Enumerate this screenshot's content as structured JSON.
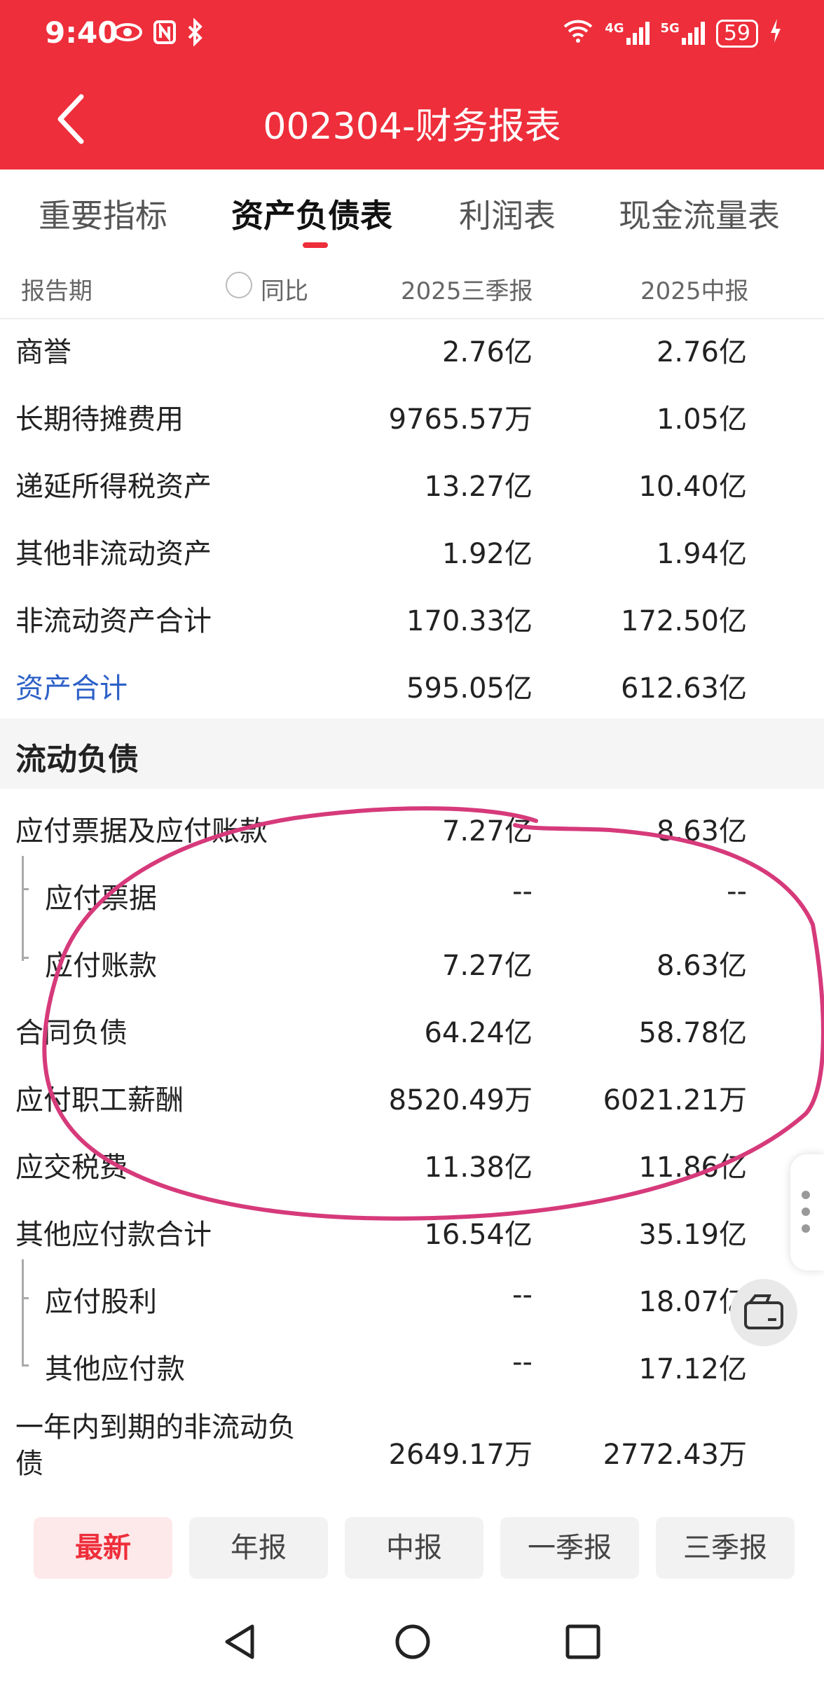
{
  "status_bar": {
    "time": "9:40",
    "battery": "59",
    "icons": [
      "eye-icon",
      "nfc-icon",
      "bluetooth-icon",
      "wifi-icon",
      "signal-4g-icon",
      "signal-5g-icon",
      "charging-icon"
    ],
    "net1": "4G",
    "net2": "5G"
  },
  "header": {
    "title": "002304-财务报表",
    "back_icon": "chevron-left-icon"
  },
  "tabs": [
    {
      "label": "重要指标"
    },
    {
      "label": "资产负债表"
    },
    {
      "label": "利润表"
    },
    {
      "label": "现金流量表"
    }
  ],
  "columns": {
    "period": "报告期",
    "yoy": "同比",
    "col1": "2025三季报",
    "col2": "2025中报"
  },
  "rows": [
    {
      "label": "商誉",
      "v1": "2.76亿",
      "v2": "2.76亿"
    },
    {
      "label": "长期待摊费用",
      "v1": "9765.57万",
      "v2": "1.05亿"
    },
    {
      "label": "递延所得税资产",
      "v1": "13.27亿",
      "v2": "10.40亿"
    },
    {
      "label": "其他非流动资产",
      "v1": "1.92亿",
      "v2": "1.94亿"
    },
    {
      "label": "非流动资产合计",
      "v1": "170.33亿",
      "v2": "172.50亿"
    },
    {
      "label": "资产合计",
      "v1": "595.05亿",
      "v2": "612.63亿"
    }
  ],
  "section": {
    "label": "流动负债"
  },
  "liabilities": [
    {
      "label": "应付票据及应付账款",
      "v1": "7.27亿",
      "v2": "8.63亿"
    },
    {
      "label": "应付票据",
      "v1": "--",
      "v2": "--"
    },
    {
      "label": "应付账款",
      "v1": "7.27亿",
      "v2": "8.63亿"
    },
    {
      "label": "合同负债",
      "v1": "64.24亿",
      "v2": "58.78亿"
    },
    {
      "label": "应付职工薪酬",
      "v1": "8520.49万",
      "v2": "6021.21万"
    },
    {
      "label": "应交税费",
      "v1": "11.38亿",
      "v2": "11.86亿"
    },
    {
      "label": "其他应付款合计",
      "v1": "16.54亿",
      "v2": "35.19亿"
    },
    {
      "label": "应付股利",
      "v1": "--",
      "v2": "18.07亿"
    },
    {
      "label": "其他应付款",
      "v1": "--",
      "v2": "17.12亿"
    },
    {
      "label_line1": "一年内到期的非流动负",
      "label_line2": "债",
      "v1": "2649.17万",
      "v2": "2772.43万"
    }
  ],
  "filters": [
    "最新",
    "年报",
    "中报",
    "一季报",
    "三季报"
  ],
  "colors": {
    "brand": "#ee2e3b",
    "link": "#2d61c8",
    "annotation": "#d63a7a"
  }
}
